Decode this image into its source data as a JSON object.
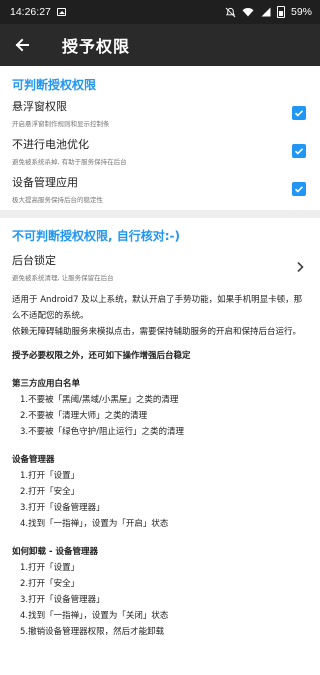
{
  "status": {
    "time": "14:26:27",
    "battery": "59%"
  },
  "appbar": {
    "title": "授予权限"
  },
  "judged": {
    "title": "可判断授权权限",
    "items": [
      {
        "label": "悬浮窗权限",
        "desc": "开启悬浮窗制作规则和显示控制条",
        "checked": true
      },
      {
        "label": "不进行电池优化",
        "desc": "避免被系统杀掉, 有助于服务保持在后台",
        "checked": true
      },
      {
        "label": "设备管理应用",
        "desc": "极大提高服务保持后台的稳定性",
        "checked": true
      }
    ]
  },
  "unjudged": {
    "title": "不可判断授权权限, 自行核对:-)",
    "item": {
      "label": "后台锁定",
      "desc": "避免被系统清理, 让服务保留在后台"
    }
  },
  "info": {
    "p1": "适用于 Android7 及以上系统，默认开启了手势功能，如果手机明显卡顿，那么不适配您的系统。",
    "p2": "依赖无障碍辅助服务来模拟点击，需要保持辅助服务的开启和保持后台运行。",
    "emph": "授予必要权限之外，还可如下操作增强后台稳定",
    "whitelist": {
      "title": "第三方应用白名单",
      "items": [
        "1.不要被「黑阈/黑域/小黑屋」之类的清理",
        "2.不要被「清理大师」之类的清理",
        "3.不要被「绿色守护/阻止运行」之类的清理"
      ]
    },
    "device_admin": {
      "title": "设备管理器",
      "items": [
        "1.打开「设置」",
        "2.打开「安全」",
        "3.打开「设备管理器」",
        "4.找到「一指禅」，设置为「开启」状态"
      ]
    },
    "uninstall": {
      "title": "如何卸载 - 设备管理器",
      "items": [
        "1.打开「设置」",
        "2.打开「安全」",
        "3.打开「设备管理器」",
        "4.找到「一指禅」，设置为「关闭」状态",
        "5.撤销设备管理器权限，然后才能卸载"
      ]
    }
  }
}
